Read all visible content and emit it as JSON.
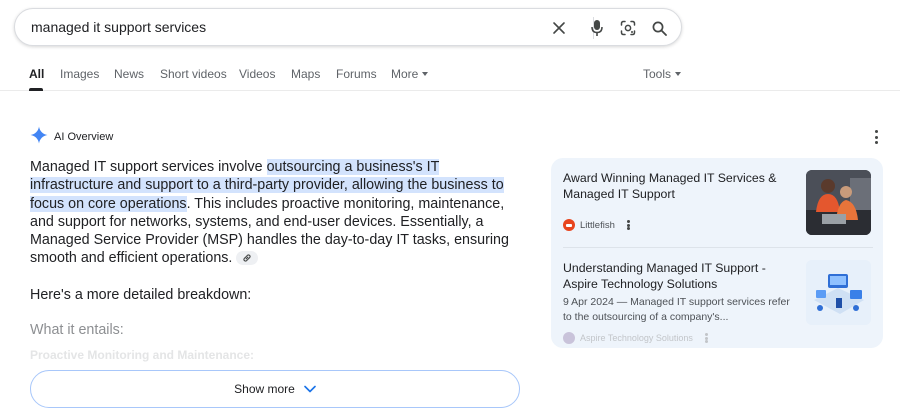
{
  "search": {
    "query": "managed it support services"
  },
  "tabs": {
    "items": [
      {
        "label": "All"
      },
      {
        "label": "Images"
      },
      {
        "label": "News"
      },
      {
        "label": "Short videos"
      },
      {
        "label": "Videos"
      },
      {
        "label": "Maps"
      },
      {
        "label": "Forums"
      },
      {
        "label": "More"
      }
    ],
    "active": "All",
    "tools_label": "Tools"
  },
  "ai_overview": {
    "title": "AI Overview",
    "para_start": "Managed IT support services involve ",
    "para_highlight": "outsourcing a business's IT infrastructure and support to a third-party provider, allowing the business to focus on core operations",
    "para_end": ". This includes proactive monitoring, maintenance, and support for networks, systems, and end-user devices. Essentially, a Managed Service Provider (MSP) handles the day-to-day IT tasks, ensuring smooth and efficient operations.",
    "breakdown": "Here's a more detailed breakdown:",
    "entails": "What it entails:",
    "faded_heading": "Proactive Monitoring and Maintenance:",
    "show_more": "Show more"
  },
  "sources": [
    {
      "title": "Award Winning Managed IT Services & Managed IT Support",
      "site": "Littlefish",
      "favicon_color": "#e8451e"
    },
    {
      "title": "Understanding Managed IT Support - Aspire Technology Solutions",
      "snippet": "9 Apr 2024 — Managed IT support services refer to the outsourcing of a company's...",
      "site": "Aspire Technology Solutions",
      "favicon_color": "#c9c3da"
    }
  ],
  "colors": {
    "highlight": "#d3e3fd",
    "card_bg": "#eef4fb",
    "show_more_border": "#a8c7fa",
    "gemini_blue": "#4285f4"
  },
  "icons": [
    "clear-icon",
    "microphone-icon",
    "google-lens-icon",
    "search-icon",
    "gemini-sparkle-icon",
    "more-vert-icon",
    "link-icon",
    "chevron-down-icon"
  ]
}
